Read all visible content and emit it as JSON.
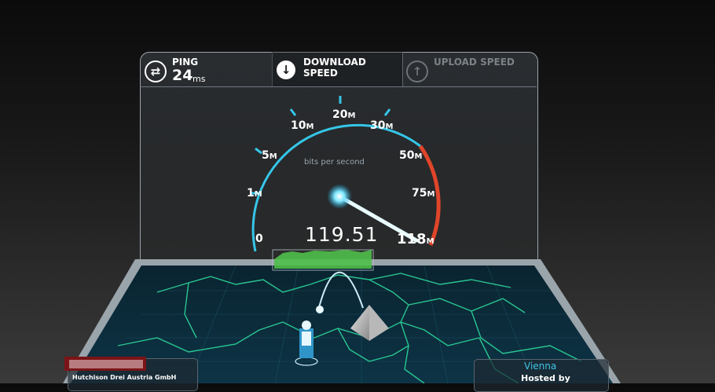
{
  "tabs": {
    "ping_label": "PING",
    "ping_value": "24",
    "ping_unit": "ms",
    "download_label": "DOWNLOAD SPEED",
    "upload_label": "UPLOAD SPEED"
  },
  "gauge": {
    "units_caption": "bits per second",
    "current_speed": "119.51",
    "ticks": [
      {
        "num": "0",
        "unit": ""
      },
      {
        "num": "1",
        "unit": "M"
      },
      {
        "num": "5",
        "unit": "M"
      },
      {
        "num": "10",
        "unit": "M"
      },
      {
        "num": "20",
        "unit": "M"
      },
      {
        "num": "30",
        "unit": "M"
      },
      {
        "num": "50",
        "unit": "M"
      },
      {
        "num": "75",
        "unit": "M"
      },
      {
        "num": "118",
        "unit": "M"
      }
    ]
  },
  "server": {
    "isp_name": "Hutchison Drei Austria GmbH",
    "city": "Vienna",
    "hosted_by": "Hosted by"
  },
  "colors": {
    "accent_cyan": "#35c6e8",
    "gauge_red": "#e0452a",
    "map_green": "#2fe0a0"
  },
  "icons": {
    "ping": "ping-arrows-icon",
    "download": "download-arrow-icon",
    "upload": "upload-arrow-icon",
    "user": "user-figure-icon",
    "server": "server-pyramid-icon"
  }
}
